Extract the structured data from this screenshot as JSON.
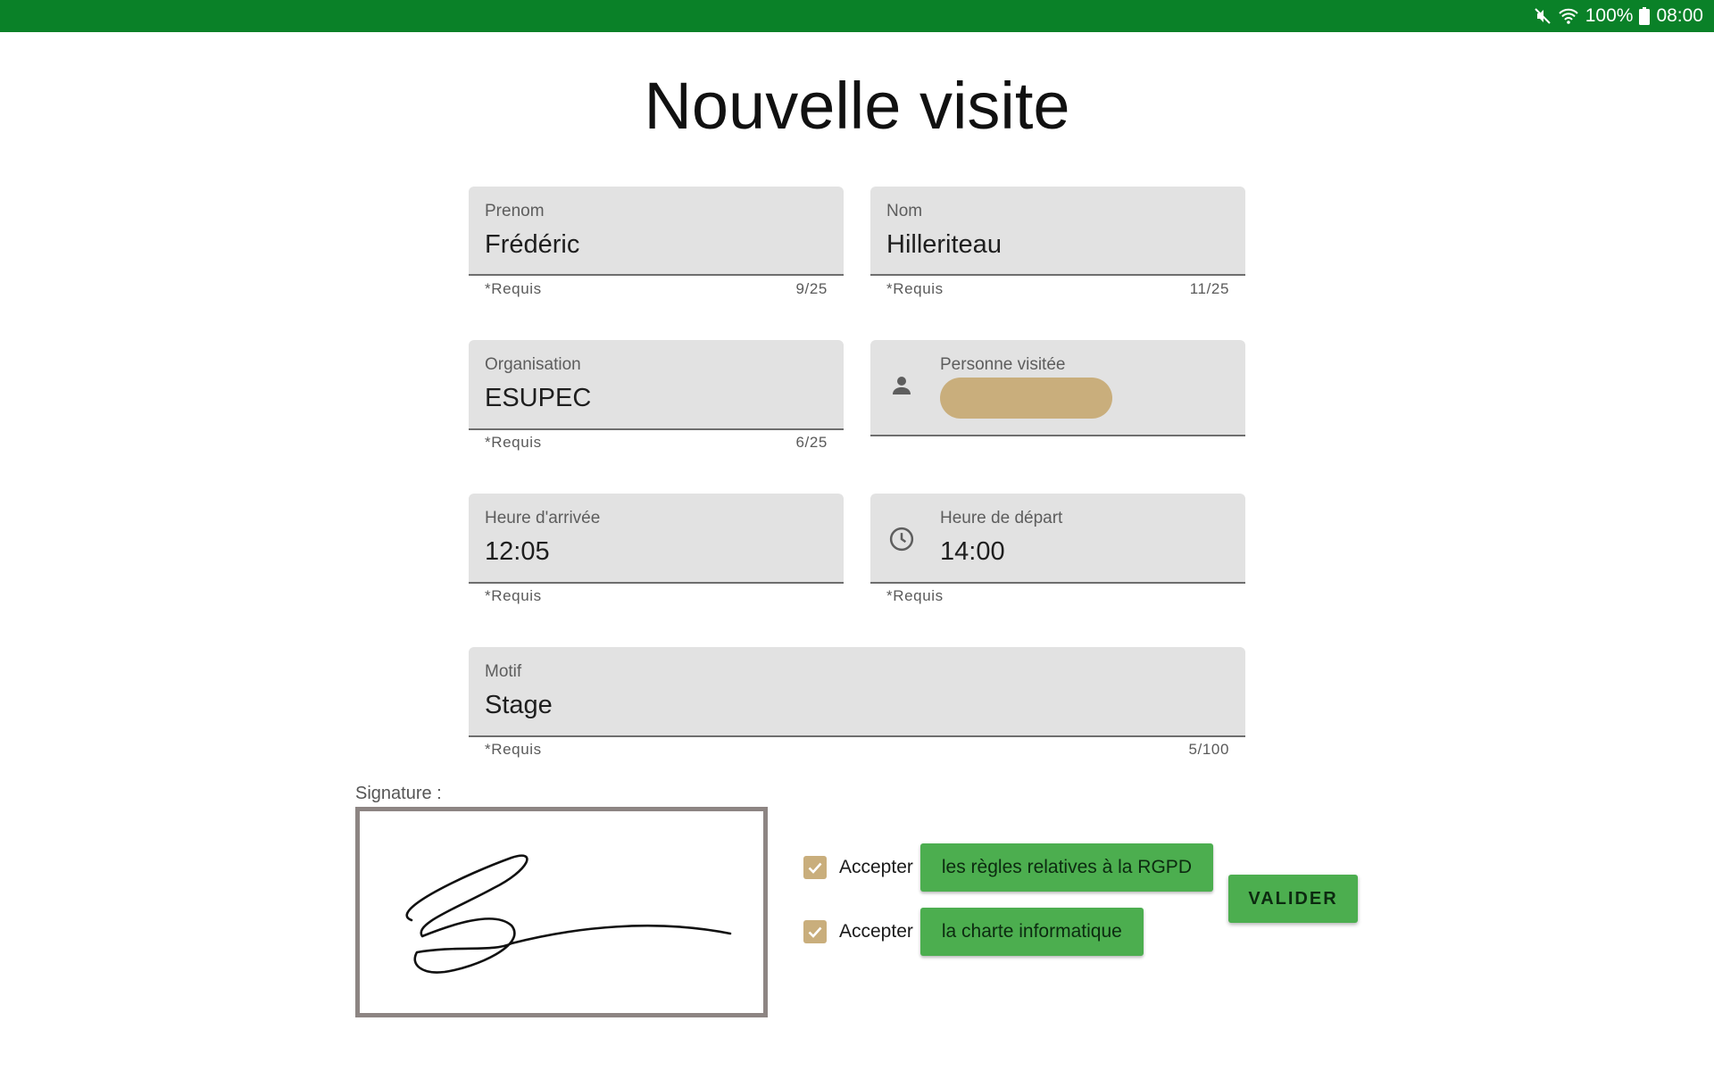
{
  "status_bar": {
    "battery": "100%",
    "time": "08:00",
    "icons": [
      "mute-icon",
      "wifi-icon",
      "battery-icon"
    ]
  },
  "title": "Nouvelle visite",
  "fields": {
    "prenom": {
      "label": "Prenom",
      "value": "Frédéric",
      "helper": "*Requis",
      "counter": "9/25"
    },
    "nom": {
      "label": "Nom",
      "value": "Hilleriteau",
      "helper": "*Requis",
      "counter": "11/25"
    },
    "organisation": {
      "label": "Organisation",
      "value": "ESUPEC",
      "helper": "*Requis",
      "counter": "6/25"
    },
    "personne_visitee": {
      "label": "Personne visitée",
      "chip_value": "",
      "icon": "person-icon"
    },
    "heure_arrivee": {
      "label": "Heure d'arrivée",
      "value": "12:05",
      "helper": "*Requis"
    },
    "heure_depart": {
      "label": "Heure de départ",
      "value": "14:00",
      "helper": "*Requis",
      "icon": "clock-icon"
    },
    "motif": {
      "label": "Motif",
      "value": "Stage",
      "helper": "*Requis",
      "counter": "5/100"
    }
  },
  "signature": {
    "label": "Signature :"
  },
  "accept": {
    "rgpd": {
      "label": "Accepter",
      "link": "les règles relatives à la RGPD",
      "checked": true
    },
    "charte": {
      "label": "Accepter",
      "link": "la charte informatique",
      "checked": true
    }
  },
  "submit_label": "VALIDER",
  "colors": {
    "status_bar": "#0a8128",
    "button_green": "#4cae4f",
    "chip_tan": "#c9ae7c",
    "field_bg": "#e2e2e2"
  }
}
